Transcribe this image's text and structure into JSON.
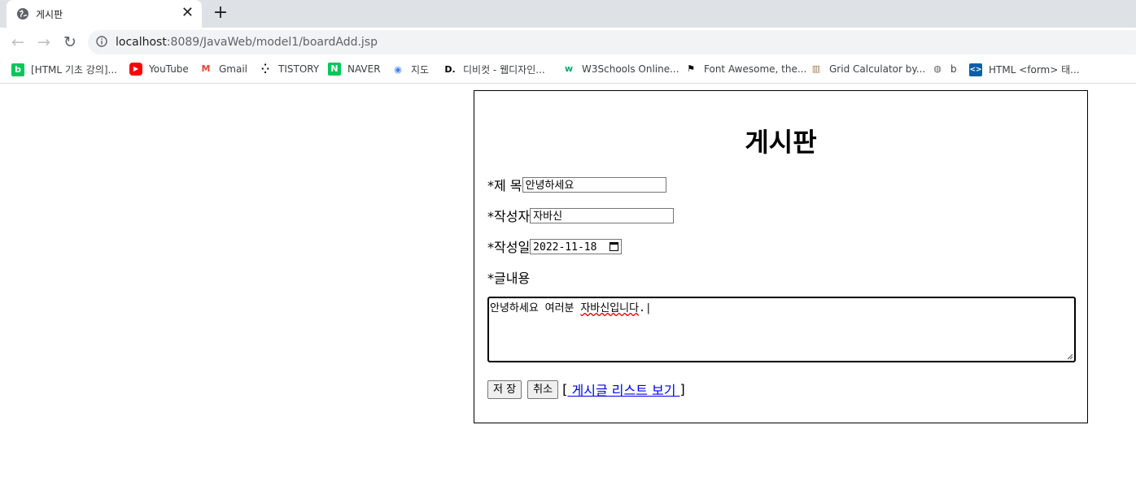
{
  "browser": {
    "tab_title": "게시판",
    "tab_close": "✕",
    "new_tab": "+",
    "url_host": "localhost",
    "url_path": ":8089/JavaWeb/model1/boardAdd.jsp",
    "nav": {
      "back": "←",
      "forward": "→",
      "reload": "↻"
    }
  },
  "bookmarks": [
    {
      "label": "[HTML 기초 강의]...",
      "icon": "blog-icon",
      "color": "#03c75a",
      "glyph": "b"
    },
    {
      "label": "YouTube",
      "icon": "youtube-icon",
      "color": "#ff0000",
      "glyph": "▶"
    },
    {
      "label": "Gmail",
      "icon": "gmail-icon",
      "color": "#ea4335",
      "glyph": "M"
    },
    {
      "label": "TISTORY",
      "icon": "tistory-icon",
      "color": "#000000",
      "glyph": "⁛"
    },
    {
      "label": "NAVER",
      "icon": "naver-icon",
      "color": "#03c75a",
      "glyph": "N"
    },
    {
      "label": "지도",
      "icon": "maps-icon",
      "color": "#4285f4",
      "glyph": "◉"
    },
    {
      "label": "디비컷 - 웹디자인...",
      "icon": "dbcut-icon",
      "color": "#000000",
      "glyph": "D."
    },
    {
      "label": "W3Schools Online...",
      "icon": "w3schools-icon",
      "color": "#04aa6d",
      "glyph": "w"
    },
    {
      "label": "Font Awesome, the...",
      "icon": "fontawesome-icon",
      "color": "#000000",
      "glyph": "⚑"
    },
    {
      "label": "Grid Calculator by...",
      "icon": "grid-calculator-icon",
      "color": "#a08050",
      "glyph": "▥"
    },
    {
      "label": "b",
      "icon": "globe-icon",
      "color": "#5f6368",
      "glyph": "◍"
    },
    {
      "label": "HTML <form> 태...",
      "icon": "code-icon",
      "color": "#0b5ea8",
      "glyph": "<>"
    }
  ],
  "page": {
    "title": "게시판",
    "subject_label": "*제 목",
    "subject_value": "안녕하세요",
    "author_label": "*작성자",
    "author_value": "자바신",
    "date_label": "*작성일",
    "date_value": "2022-11-18",
    "content_label": "*글내용",
    "content_plain": "안녕하세요 여러분 ",
    "content_misspelled": "자바신입니다",
    "content_tail": ".|",
    "save_button": "저 장",
    "cancel_button": "취소",
    "bracket_open": "[",
    "list_link": " 게시글 리스트 보기 ",
    "bracket_close": "]"
  }
}
